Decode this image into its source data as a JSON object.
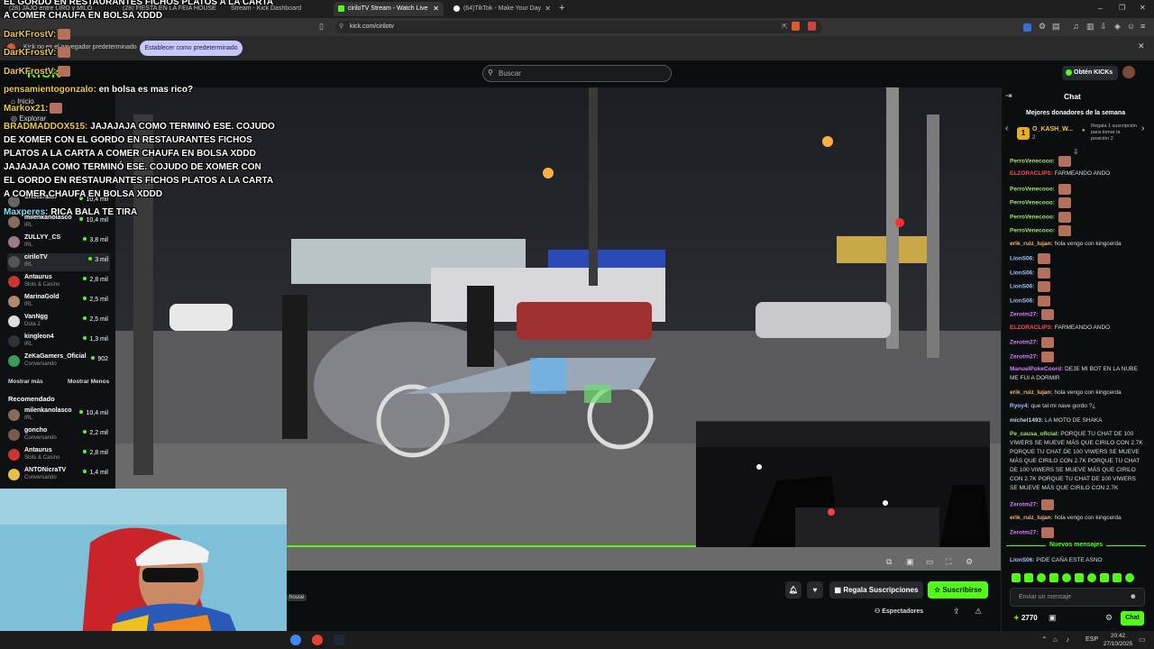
{
  "colors": {
    "accent": "#53fc18",
    "bg": "#0b0e0f",
    "set_default_btn": "#c7c6ff"
  },
  "browser": {
    "tabs": [
      {
        "label": "(28) JAJO entre LIRO y MILO",
        "active": false
      },
      {
        "label": "(28) FIESTA EN LA FEIA HOUSE",
        "active": false
      },
      {
        "label": "Stream - Kick Dashboard",
        "active": false
      },
      {
        "label": "ciriloTV Stream - Watch Live",
        "active": true
      },
      {
        "label": "(64)TikTok - Make Your Day",
        "active": false
      }
    ],
    "url": "kick.com/cirilotv",
    "infobar_text": "Kick no es el navegador predeterminado",
    "set_default_label": "Establecer como predeterminado"
  },
  "header": {
    "logo": "KICK",
    "search_placeholder": "Buscar",
    "kicks_button": "Obtén KICKs"
  },
  "sidebar": {
    "nav": [
      "Inicio",
      "Explorar"
    ],
    "following": [
      {
        "name": "Cristorata7",
        "cat": "IRL",
        "count": "10,4 mil"
      },
      {
        "name": "milenkanolasco",
        "cat": "IRL",
        "count": "10,4 mil"
      },
      {
        "name": "ZULLYY_CS",
        "cat": "IRL",
        "count": "3,8 mil"
      },
      {
        "name": "ciriloTV",
        "cat": "IRL",
        "count": "3 mil"
      },
      {
        "name": "Antaurus",
        "cat": "Slots & Casino",
        "count": "2,8 mil"
      },
      {
        "name": "MarinaGold",
        "cat": "IRL",
        "count": "2,5 mil"
      },
      {
        "name": "VanNgg",
        "cat": "Dota 2",
        "count": "2,5 mil"
      },
      {
        "name": "kingleon4",
        "cat": "IRL",
        "count": "1,3 mil"
      },
      {
        "name": "ZeKaGamers_Oficial",
        "cat": "Conversando",
        "count": "902"
      }
    ],
    "show_more": "Mostrar más",
    "show_less": "Mostrar Menos",
    "recommended_title": "Recomendado",
    "recommended": [
      {
        "name": "milenkanolasco",
        "cat": "IRL",
        "count": "10,4 mil"
      },
      {
        "name": "goncho",
        "cat": "Conversando",
        "count": "2,2 mil"
      },
      {
        "name": "Antaurus",
        "cat": "Slots & Casino",
        "count": "2,8 mil"
      },
      {
        "name": "ANTONicraTV",
        "cat": "Conversando",
        "count": "1,4 mil"
      }
    ]
  },
  "overlay_chat": [
    {
      "user": "",
      "text": "EL GORDO EN RESTAURANTES FICHOS PLATOS A LA CARTA"
    },
    {
      "user": "",
      "text": "A COMER CHAUFA EN BOLSA XDDD"
    },
    {
      "user": "DarKFrostV:",
      "text": ""
    },
    {
      "user": "DarKFrostV:",
      "text": ""
    },
    {
      "user": "DarKFrostV:",
      "text": ""
    },
    {
      "user": "pensamientogonzalo:",
      "text": "en bolsa es mas rico?"
    },
    {
      "user": "Markox21:",
      "text": ""
    },
    {
      "user": "BRADMADDOX515:",
      "text": "JAJAJAJA COMO TERMINÓ ESE. COJUDO"
    },
    {
      "user": "",
      "text": "DE XOMER CON EL GORDO EN RESTAURANTES FICHOS"
    },
    {
      "user": "",
      "text": "PLATOS A LA CARTA A COMER CHAUFA EN BOLSA XDDD"
    },
    {
      "user": "",
      "text": "JAJAJAJA COMO TERMINÓ ESE. COJUDO DE XOMER CON"
    },
    {
      "user": "",
      "text": "EL GORDO EN RESTAURANTES FICHOS PLATOS A LA CARTA"
    },
    {
      "user": "",
      "text": "A COMER CHAUFA EN BOLSA XDDD"
    },
    {
      "user": "Maxperes:",
      "text": "RICA BALA TE TIRA"
    }
  ],
  "video": {
    "buttons": {
      "gift": "Regala Suscripciones",
      "subscribe": "Suscribirse"
    },
    "viewers_label": "Espectadores",
    "streamer_tag": "house"
  },
  "chat": {
    "title": "Chat",
    "top_donors_title": "Mejores donadores de la semana",
    "top_donor_name": "O_KASH_W...",
    "top_donor_amount": "2",
    "gift_prompt": "Regala 1 suscripción para tomar la posición 2",
    "messages": [
      {
        "user": "PerroVenecooo:",
        "text": "",
        "color": "#9fe870",
        "emote": true
      },
      {
        "user": "ELZORACLIPS:",
        "text": "FARMEANDO ANDO",
        "color": "#ff4a4a",
        "emote": false
      },
      {
        "user": "PerroVenecooo:",
        "text": "",
        "color": "#9fe870",
        "emote": true
      },
      {
        "user": "PerroVenecooo:",
        "text": "",
        "color": "#9fe870",
        "emote": true
      },
      {
        "user": "PerroVenecooo:",
        "text": "",
        "color": "#9fe870",
        "emote": true
      },
      {
        "user": "PerroVenecooo:",
        "text": "",
        "color": "#9fe870",
        "emote": true
      },
      {
        "user": "erik_ruiz_lujan:",
        "text": "hola vengo con kingcerda",
        "color": "#ffb36b",
        "emote": false
      },
      {
        "user": "LionS06:",
        "text": "",
        "color": "#a0c0ff",
        "emote": true
      },
      {
        "user": "LionS06:",
        "text": "",
        "color": "#a0c0ff",
        "emote": true
      },
      {
        "user": "LionS06:",
        "text": "",
        "color": "#a0c0ff",
        "emote": true
      },
      {
        "user": "LionS06:",
        "text": "",
        "color": "#a0c0ff",
        "emote": true
      },
      {
        "user": "Zerotm27:",
        "text": "",
        "color": "#d87bff",
        "emote": true
      },
      {
        "user": "ELZORACLIPS:",
        "text": "FARMEANDO ANDO",
        "color": "#ff4a4a",
        "emote": false
      },
      {
        "user": "Zerotm27:",
        "text": "",
        "color": "#d87bff",
        "emote": true
      },
      {
        "user": "Zerotm27:",
        "text": "",
        "color": "#d87bff",
        "emote": true
      },
      {
        "user": "ManuelPokeCoord:",
        "text": "DEJE MI BOT EN LA NUBE ME FUI A DORMIR",
        "color": "#d87bff",
        "emote": false
      },
      {
        "user": "erik_ruiz_lujan:",
        "text": "hola vengo con kingcerda",
        "color": "#ffb36b",
        "emote": false
      },
      {
        "user": "Ryoy4:",
        "text": "que tal mi nave gordo ?¿",
        "color": "#a0c0ff",
        "emote": false
      },
      {
        "user": "michel1493:",
        "text": "LA MOTO DE SHAKA",
        "color": "#cccccc",
        "emote": false
      },
      {
        "user": "Pe_causa_oficial:",
        "text": "PORQUE TU CHAT DE 100 VIWERS SE MUEVE MÁS QUE CIRILO CON 2.7K PORQUE TU CHAT DE 100 VIWERS SE MUEVE MÁS QUE CIRILO CON 2.7K PORQUE TU CHAT DE 100 VIWERS SE MUEVE MÁS QUE CIRILO CON 2.7K PORQUE TU CHAT DE 100 VIWERS SE MUEVE MÁS QUE CIRILO CON 2.7K",
        "color": "#9fe870",
        "emote": false
      },
      {
        "user": "Zerotm27:",
        "text": "",
        "color": "#d87bff",
        "emote": true
      },
      {
        "user": "erik_ruiz_lujan:",
        "text": "hola vengo con kingcerda",
        "color": "#ffb36b",
        "emote": false
      },
      {
        "user": "Zerotm27:",
        "text": "",
        "color": "#d87bff",
        "emote": true
      }
    ],
    "new_messages": "Nuevos mensajes",
    "last_message": {
      "user": "LionS06:",
      "text": "PIDE CAÑA ESTE ASNO"
    },
    "input_placeholder": "Enviar un mensaje",
    "kicks_balance": "2770",
    "send_button": "Chat"
  },
  "taskbar": {
    "lang": "ESP",
    "time": "20:42",
    "date": "27/10/2025"
  }
}
